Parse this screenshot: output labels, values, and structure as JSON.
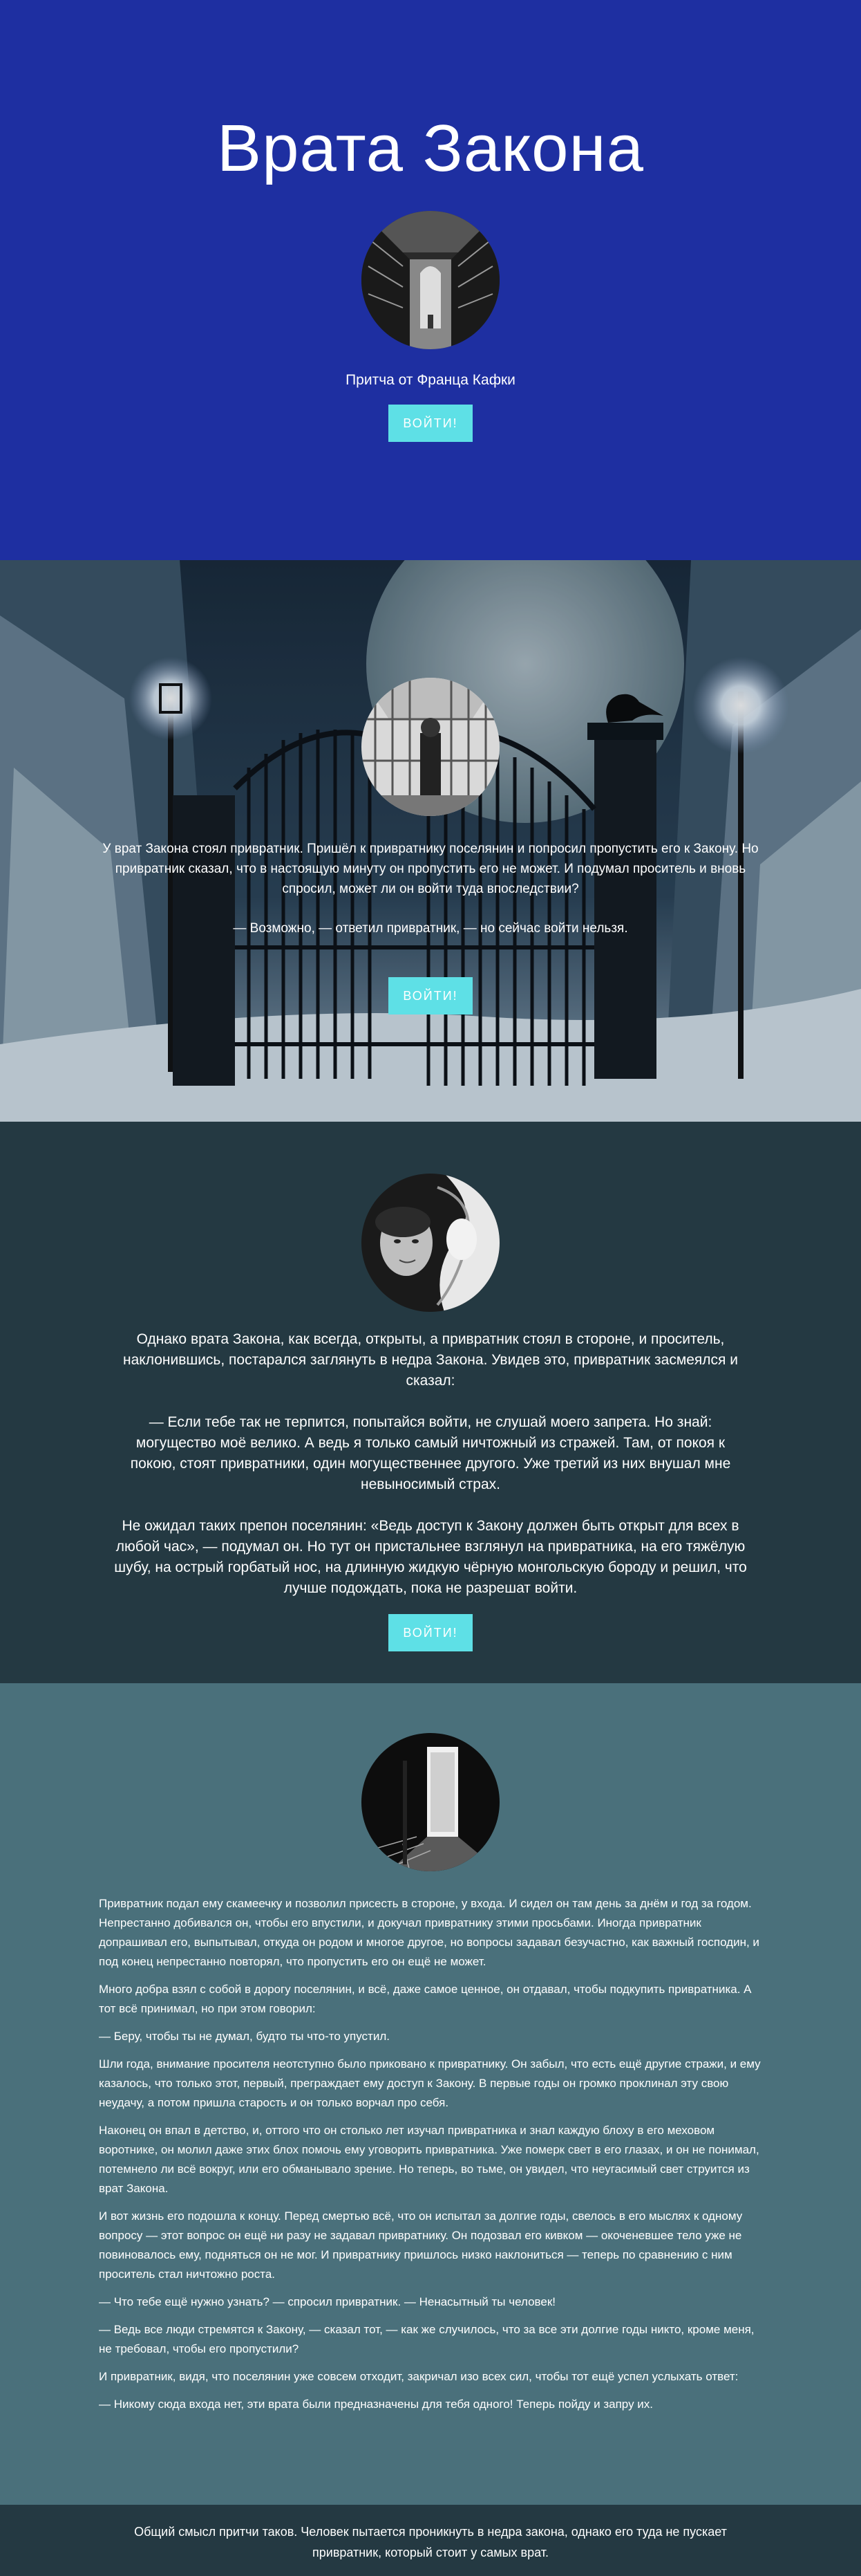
{
  "hero": {
    "title": "Врата Закона",
    "subtitle": "Притча от Франца Кафки",
    "button_label": "ВОЙТИ!"
  },
  "gate_section": {
    "paragraphs": [
      "У врат Закона стоял привратник. Пришёл к привратнику поселянин и попросил пропустить его к Закону. Но привратник сказал, что в настоящую минуту он пропустить его не может. И подумал проситель и вновь спросил, может ли он войти туда впоследствии?",
      "— Возможно, — ответил привратник, — но сейчас войти нельзя."
    ],
    "button_label": "ВОЙТИ!"
  },
  "dark_section": {
    "paragraphs": [
      "Однако врата Закона, как всегда, открыты, а привратник стоял в стороне, и проситель, наклонившись, постарался заглянуть в недра Закона. Увидев это, привратник засмеялся и сказал:",
      "— Если тебе так не терпится, попытайся войти, не слушай моего запрета. Но знай: могущество моё велико. А ведь я только самый ничтожный из стражей. Там, от покоя к покою, стоят привратники, один могущественнее другого. Уже третий из них внушал мне невыносимый страх.",
      "Не ожидал таких препон поселянин: «Ведь доступ к Закону должен быть открыт для всех в любой час», — подумал он. Но тут он пристальнее взглянул на привратника, на его тяжёлую шубу, на острый горбатый нос, на длинную жидкую чёрную монгольскую бороду и решил, что лучше подождать, пока не разрешат войти."
    ],
    "button_label": "ВОЙТИ!"
  },
  "story_section": {
    "paragraphs": [
      "Привратник подал ему скамеечку и позволил присесть в стороне, у входа. И сидел он там день за днём и год за годом. Непрестанно добивался он, чтобы его впустили, и докучал привратнику этими просьбами. Иногда привратник допрашивал его, выпытывал, откуда он родом и многое другое, но вопросы задавал безучастно, как важный господин, и под конец непрестанно повторял, что пропустить его он ещё не может.",
      "Много добра взял с собой в дорогу поселянин, и всё, даже самое ценное, он отдавал, чтобы подкупить привратника. А тот всё принимал, но при этом говорил:",
      "— Беру, чтобы ты не думал, будто ты что-то упустил.",
      "Шли года, внимание просителя неотступно было приковано к привратнику. Он забыл, что есть ещё другие стражи, и ему казалось, что только этот, первый, преграждает ему доступ к Закону. В первые годы он громко проклинал эту свою неудачу, а потом пришла старость и он только ворчал про себя.",
      "Наконец он впал в детство, и, оттого что он столько лет изучал привратника и знал каждую блоху в его меховом воротнике, он молил даже этих блох помочь ему уговорить привратника. Уже померк свет в его глазах, и он не понимал, потемнело ли всё вокруг, или его обманывало зрение. Но теперь, во тьме, он увидел, что неугасимый свет струится из врат Закона.",
      "И вот жизнь его подошла к концу. Перед смертью всё, что он испытал за долгие годы, свелось в его мыслях к одному вопросу — этот вопрос он ещё ни разу не задавал привратнику. Он подозвал его кивком — окоченевшее тело уже не повиновалось ему, подняться он не мог. И привратнику пришлось низко наклониться — теперь по сравнению с ним проситель стал ничтожно роста.",
      "— Что тебе ещё нужно узнать? — спросил привратник. — Ненасытный ты человек!",
      "— Ведь все люди стремятся к Закону, — сказал тот, — как же случилось, что за все эти долгие годы никто, кроме меня, не требовал, чтобы его пропустили?",
      "И привратник, видя, что поселянин уже совсем отходит, закричал изо всех сил, чтобы тот ещё успел услыхать ответ:",
      "— Никому сюда входа нет, эти врата были предназначены для тебя одного! Теперь пойду и запру их."
    ]
  },
  "footer": {
    "text": "Общий смысл притчи таков. Человек пытается проникнуть в недра закона, однако его туда не пускает привратник, который стоит у самых врат."
  },
  "colors": {
    "hero_bg": "#1e2fa1",
    "dark_bg": "#243942",
    "story_bg": "#4a707b",
    "button_bg": "#5ee0e6"
  }
}
